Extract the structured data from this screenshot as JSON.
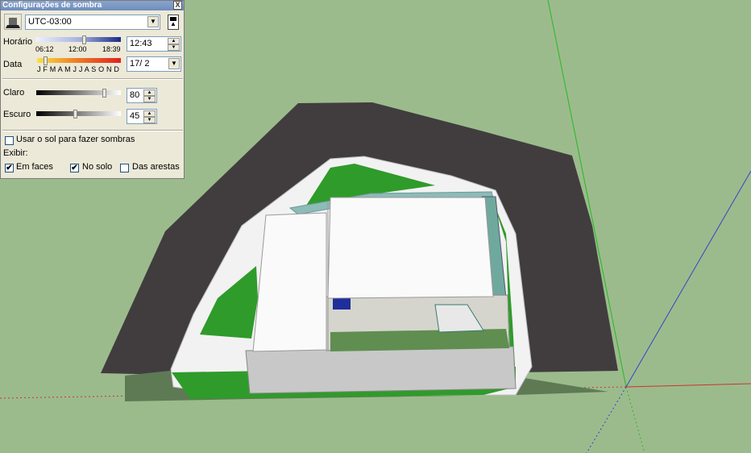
{
  "dialog": {
    "title": "Configurações de sombra",
    "close_label": "X",
    "timezone": "UTC-03:00",
    "time": {
      "label": "Horário",
      "ticks": [
        "06:12",
        "12:00",
        "18:39"
      ],
      "value": "12:43"
    },
    "date": {
      "label": "Data",
      "months": "J F M A M J J A S O N D",
      "value": "17/ 2"
    },
    "light": {
      "label": "Claro",
      "value": "80"
    },
    "dark": {
      "label": "Escuro",
      "value": "45"
    },
    "use_sun": {
      "label": "Usar o sol para fazer sombras",
      "checked": false
    },
    "display_label": "Exibir:",
    "on_faces": {
      "label": "Em faces",
      "checked": true
    },
    "on_ground": {
      "label": "No solo",
      "checked": true
    },
    "from_edges": {
      "label": "Das arestas",
      "checked": false
    },
    "check_mark": "✔"
  },
  "colors": {
    "background": "#9cbb8c",
    "shadow": "#413d3f",
    "grass": "#2f9b2a",
    "axis_red": "#cc3333",
    "axis_green": "#22bb22",
    "axis_blue": "#3344cc"
  }
}
